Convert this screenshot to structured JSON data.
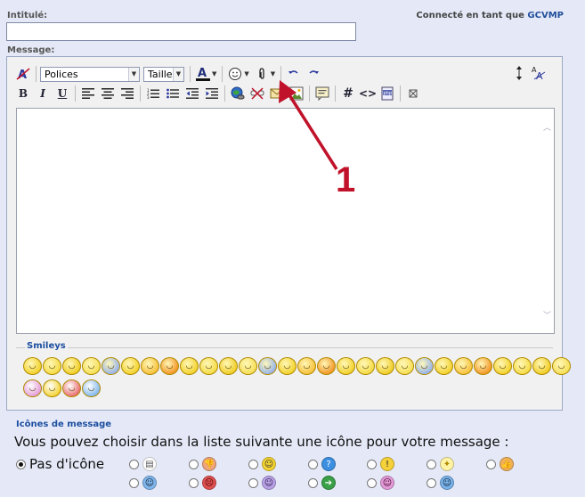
{
  "form": {
    "title_label": "Intitulé:",
    "message_label": "Message:",
    "connected_prefix": "Connecté en tant que",
    "connected_user": "GCVMP",
    "title_value": ""
  },
  "toolbar": {
    "font_select": "Polices",
    "size_select": "Taille:"
  },
  "editor": {
    "content": ""
  },
  "smileys": {
    "legend": "Smileys",
    "row1_count": 28,
    "row2_count": 4
  },
  "message_icons": {
    "legend": "Icônes de message",
    "description": "Vous pouvez choisir dans la liste suivante une icône pour votre message :",
    "none_label": "Pas d'icône",
    "selected": "none",
    "icon_names": [
      "document-icon",
      "thumbs-down-icon",
      "smile-icon",
      "question-icon",
      "warning-icon",
      "lightbulb-icon",
      "thumbs-up-icon",
      "cool-icon",
      "angry-icon",
      "purple-smile-icon",
      "arrow-right-icon",
      "laugh-icon",
      "blue-smile-icon"
    ]
  },
  "annotation": {
    "label": "1",
    "color": "#c0122a"
  },
  "colors": {
    "background": "#e5e9f7",
    "accent_blue": "#1d4fa0",
    "annotation_red": "#c0122a"
  }
}
